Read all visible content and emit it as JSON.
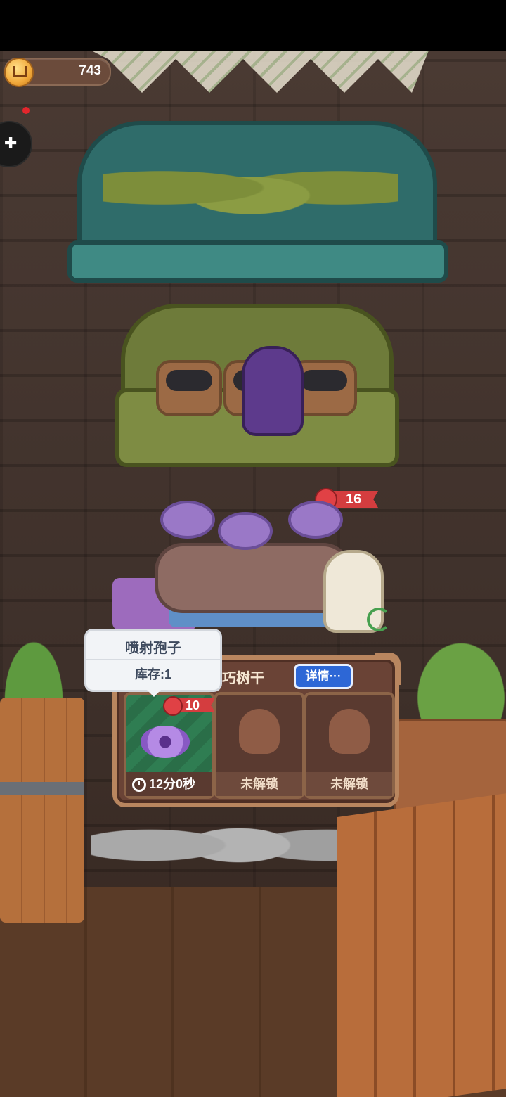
{
  "currency": {
    "value": "743",
    "icon": "coin-house-icon"
  },
  "side_button": {
    "icon": "puzzle-icon",
    "has_notification": true
  },
  "badge_main": {
    "icon": "apple-icon",
    "value": "16"
  },
  "tooltip": {
    "title": "喷射孢子",
    "stock": "库存:1"
  },
  "panel": {
    "title": "巧树干",
    "details_label": "详情···",
    "slots": [
      {
        "item": "spore-icon",
        "cost": "10",
        "timer": "12分0秒",
        "state": "active"
      },
      {
        "item": "locked-silhouette-icon",
        "label": "未解锁",
        "state": "locked"
      },
      {
        "item": "locked-silhouette-icon",
        "label": "未解锁",
        "state": "locked"
      }
    ]
  }
}
